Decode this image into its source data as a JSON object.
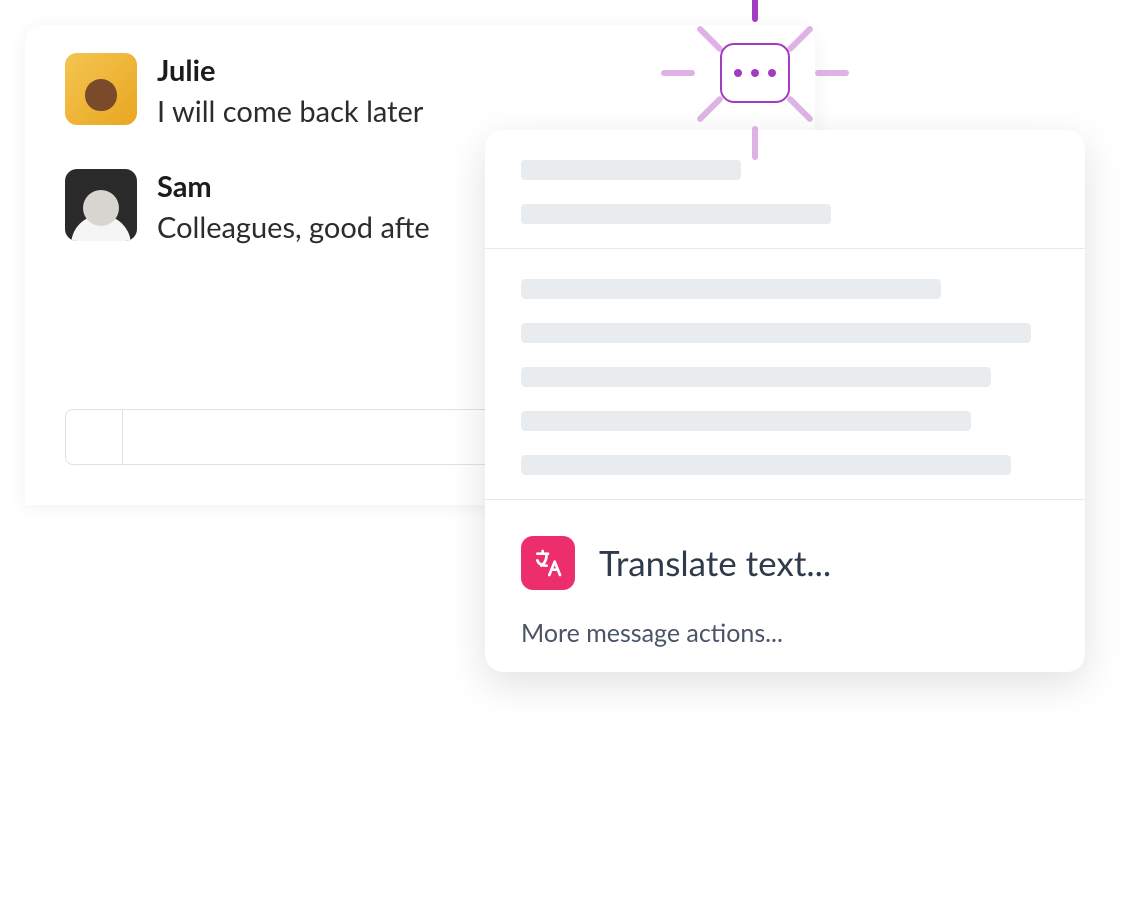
{
  "messages": [
    {
      "user": "Julie",
      "text": "I will come back later"
    },
    {
      "user": "Sam",
      "text": "Colleagues, good afte"
    }
  ],
  "menu": {
    "translate_label": "Translate text...",
    "more_actions_label": "More message actions...",
    "translate_icon_name": "translate-icon",
    "more_button_icon_name": "more-horizontal-icon"
  },
  "colors": {
    "accent_purple": "#a33cc0",
    "accent_pink": "#ed2e6c"
  }
}
